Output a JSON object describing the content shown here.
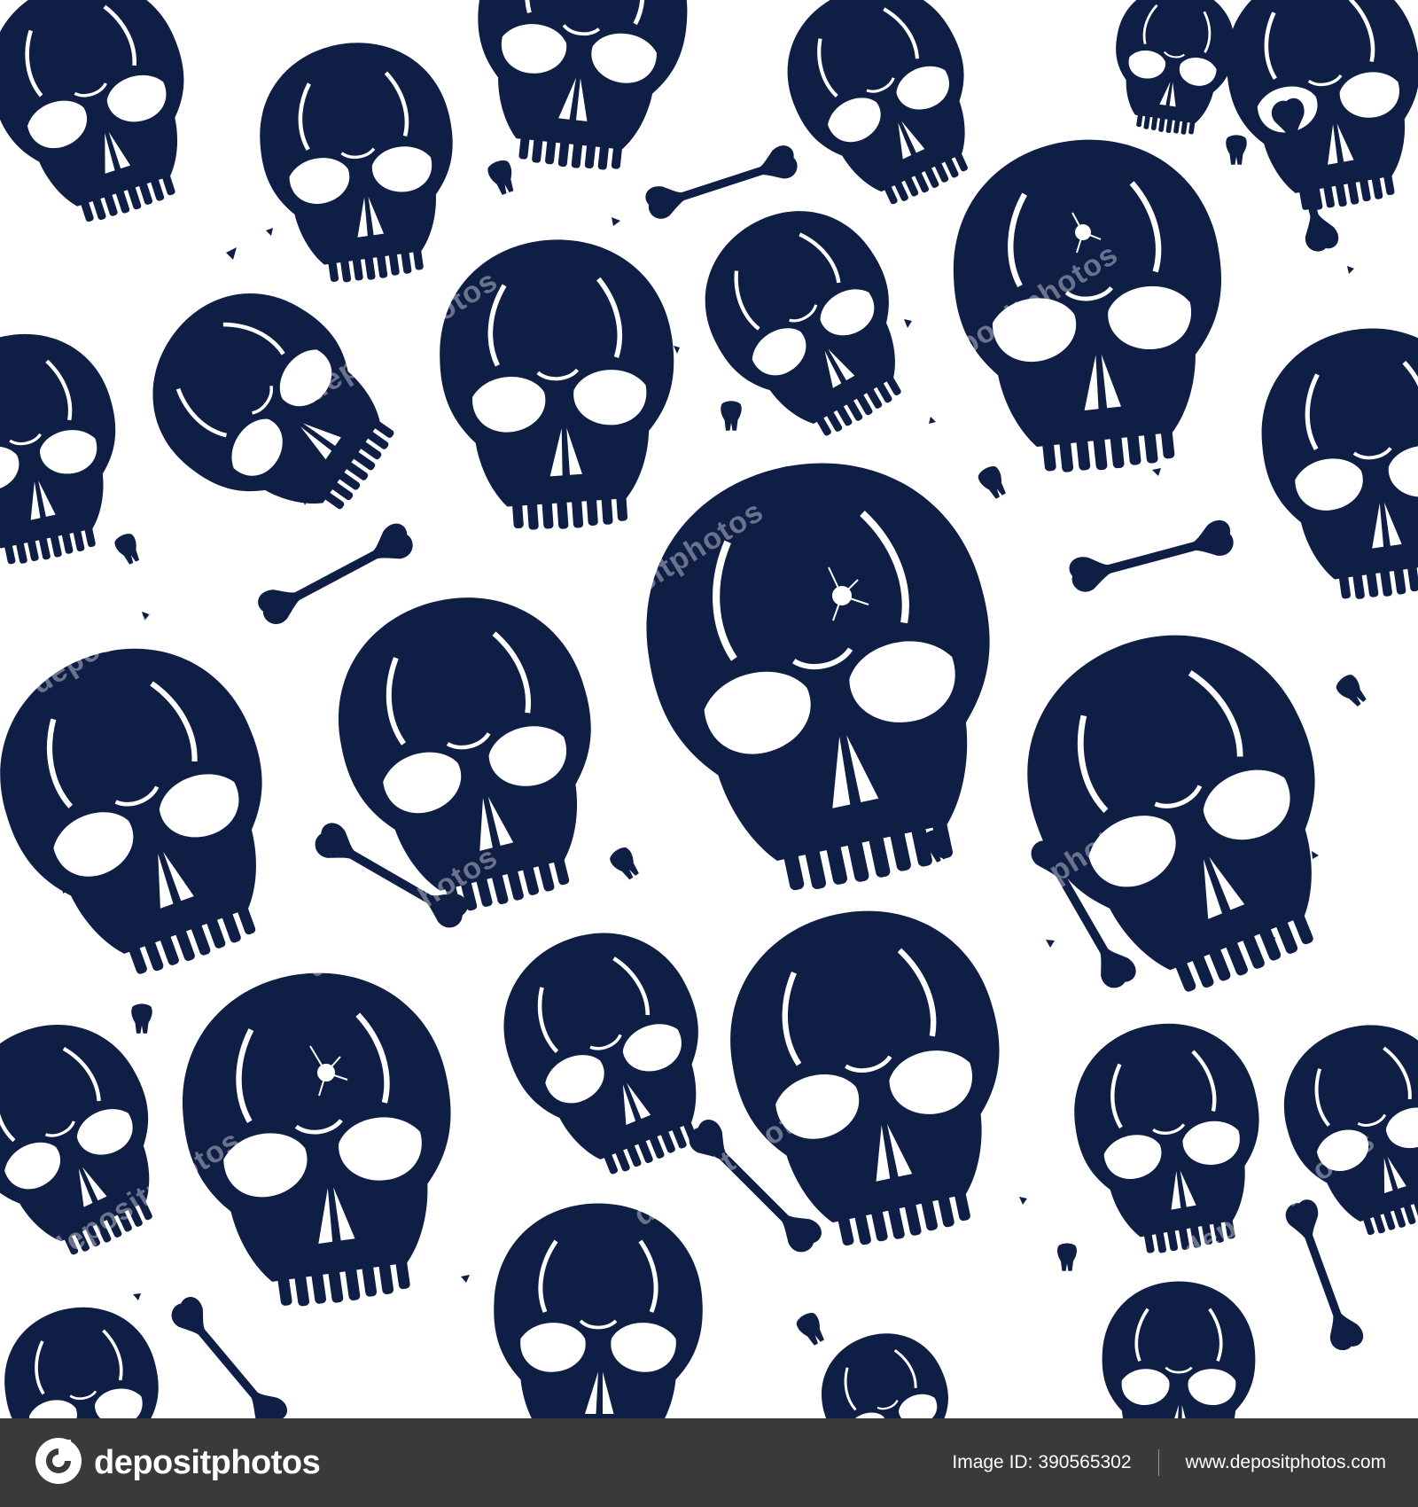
{
  "artwork": {
    "description_colors": {
      "navy": "#0f1e45",
      "background": "#ffffff"
    },
    "watermark_text": "depositphotos",
    "icon": "skull-pattern"
  },
  "footer": {
    "brand": "depositphotos",
    "brand_icon": "depositphotos-logo-icon",
    "image_id_label": "Image ID:",
    "image_id": "390565302",
    "url": "www.depositphotos.com",
    "background": "#3a3a3a"
  }
}
